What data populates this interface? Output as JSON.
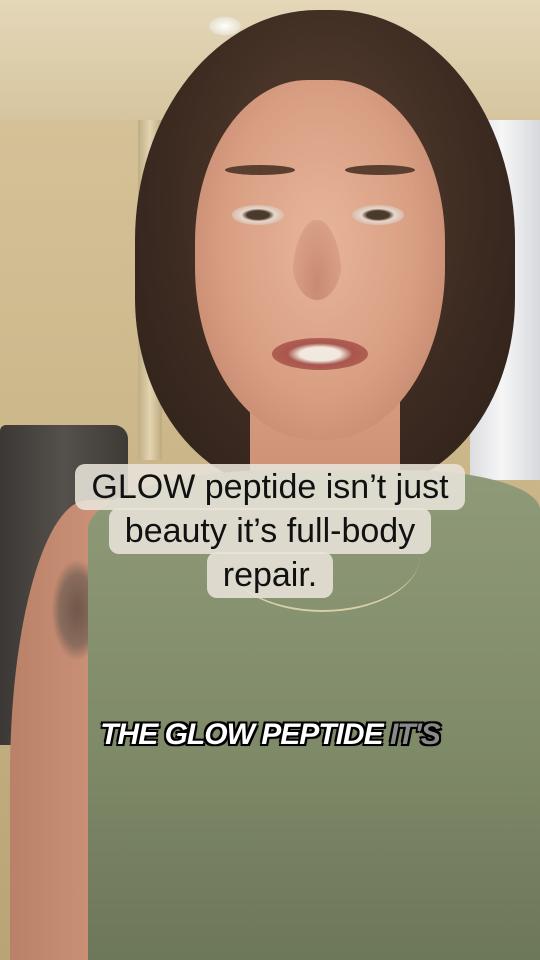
{
  "overlay_caption": {
    "lines": [
      "GLOW peptide isn’t just",
      "beauty it’s full-body",
      "repair."
    ]
  },
  "subtitle": {
    "spoken": "THE GLOW PEPTIDE",
    "upcoming": "IT'S",
    "spoken_color": "#ffffff",
    "upcoming_color": "#8a8a8a"
  }
}
